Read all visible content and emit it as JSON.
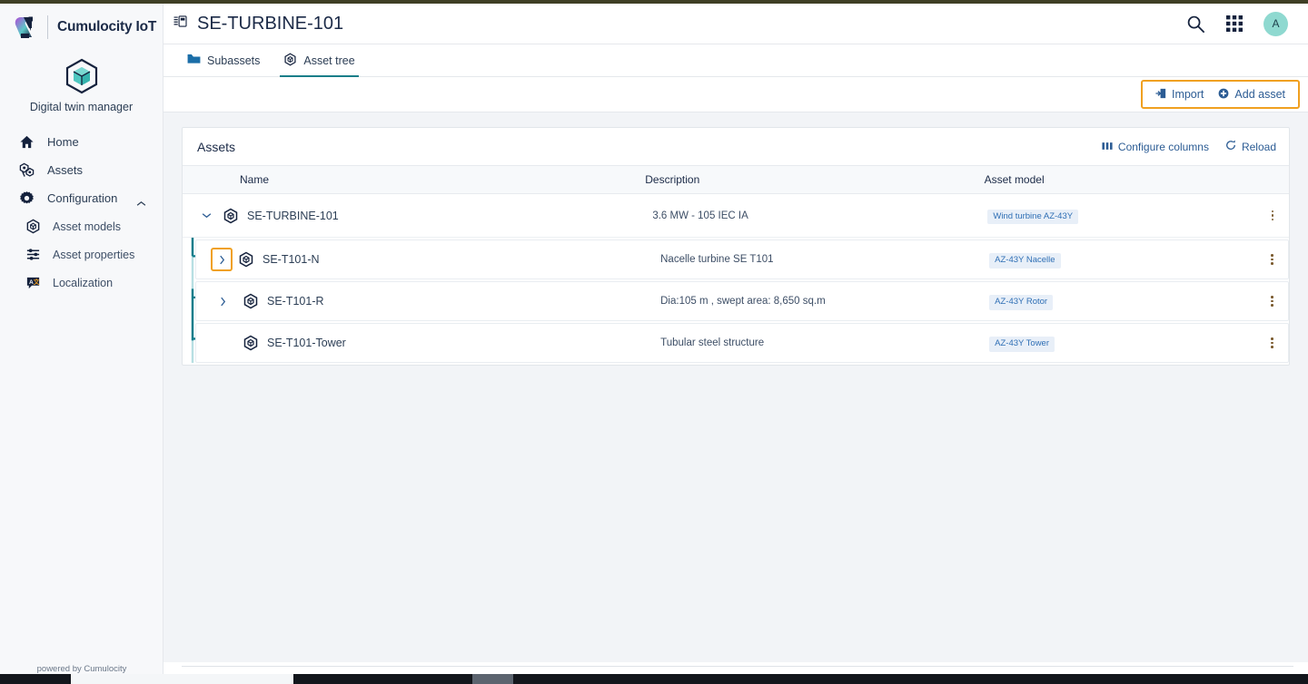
{
  "brand": {
    "name": "Cumulocity IoT",
    "logo_icon": "cumulocity-logo-icon",
    "app_icon": "digital-twin-cube-icon",
    "app_label": "Digital twin manager",
    "powered_by": "powered by Cumulocity"
  },
  "sidebar": {
    "items": [
      {
        "label": "Home",
        "icon": "home-icon",
        "name": "home"
      },
      {
        "label": "Assets",
        "icon": "assets-icon",
        "name": "assets"
      },
      {
        "label": "Configuration",
        "icon": "gear-icon",
        "name": "configuration",
        "expanded": true,
        "chevron": "chevron-up-icon"
      }
    ],
    "subitems": [
      {
        "label": "Asset models",
        "icon": "asset-model-icon",
        "name": "asset-models"
      },
      {
        "label": "Asset properties",
        "icon": "sliders-icon",
        "name": "asset-properties"
      },
      {
        "label": "Localization",
        "icon": "translate-icon",
        "name": "localization"
      }
    ]
  },
  "header": {
    "title": "SE-TURBINE-101",
    "title_icon": "asset-details-icon",
    "search_icon": "search-icon",
    "apps_icon": "app-grid-icon",
    "avatar_initial": "A"
  },
  "tabs": [
    {
      "label": "Subassets",
      "icon": "folder-icon",
      "active": false,
      "name": "tab-subassets"
    },
    {
      "label": "Asset tree",
      "icon": "asset-tree-icon",
      "active": true,
      "name": "tab-asset-tree"
    }
  ],
  "actionbar": {
    "highlighted": true,
    "buttons": [
      {
        "label": "Import",
        "icon": "import-icon",
        "name": "import-button"
      },
      {
        "label": "Add asset",
        "icon": "plus-circle-icon",
        "name": "add-asset-button"
      }
    ]
  },
  "card": {
    "title": "Assets",
    "actions": [
      {
        "label": "Configure columns",
        "icon": "columns-icon",
        "name": "configure-columns-button"
      },
      {
        "label": "Reload",
        "icon": "refresh-icon",
        "name": "reload-button"
      }
    ],
    "columns": [
      "Name",
      "Description",
      "Asset model"
    ],
    "rows": [
      {
        "name": "SE-TURBINE-101",
        "description": "3.6 MW - 105 IEC IA",
        "model": "Wind turbine AZ-43Y",
        "level": 0,
        "twisty": "chevron-down-icon",
        "twisty_highlighted": false
      },
      {
        "name": "SE-T101-N",
        "description": "Nacelle turbine SE T101",
        "model": "AZ-43Y Nacelle",
        "level": 1,
        "twisty": "chevron-right-icon",
        "twisty_highlighted": true
      },
      {
        "name": "SE-T101-R",
        "description": "Dia:105 m , swept area: 8,650 sq.m",
        "model": "AZ-43Y Rotor",
        "level": 1,
        "twisty": "chevron-right-icon",
        "twisty_highlighted": false
      },
      {
        "name": "SE-T101-Tower",
        "description": "Tubular steel structure",
        "model": "AZ-43Y Tower",
        "level": 1,
        "twisty": "none",
        "twisty_highlighted": false
      }
    ]
  },
  "colors": {
    "accent_teal": "#177e89",
    "highlight_orange": "#f0a020",
    "link_blue": "#2c5c94",
    "badge_bg": "#e8eff8",
    "badge_text": "#2f6fb5",
    "avatar_bg": "#8fd9d0",
    "top_strip": "#3f3f25"
  }
}
